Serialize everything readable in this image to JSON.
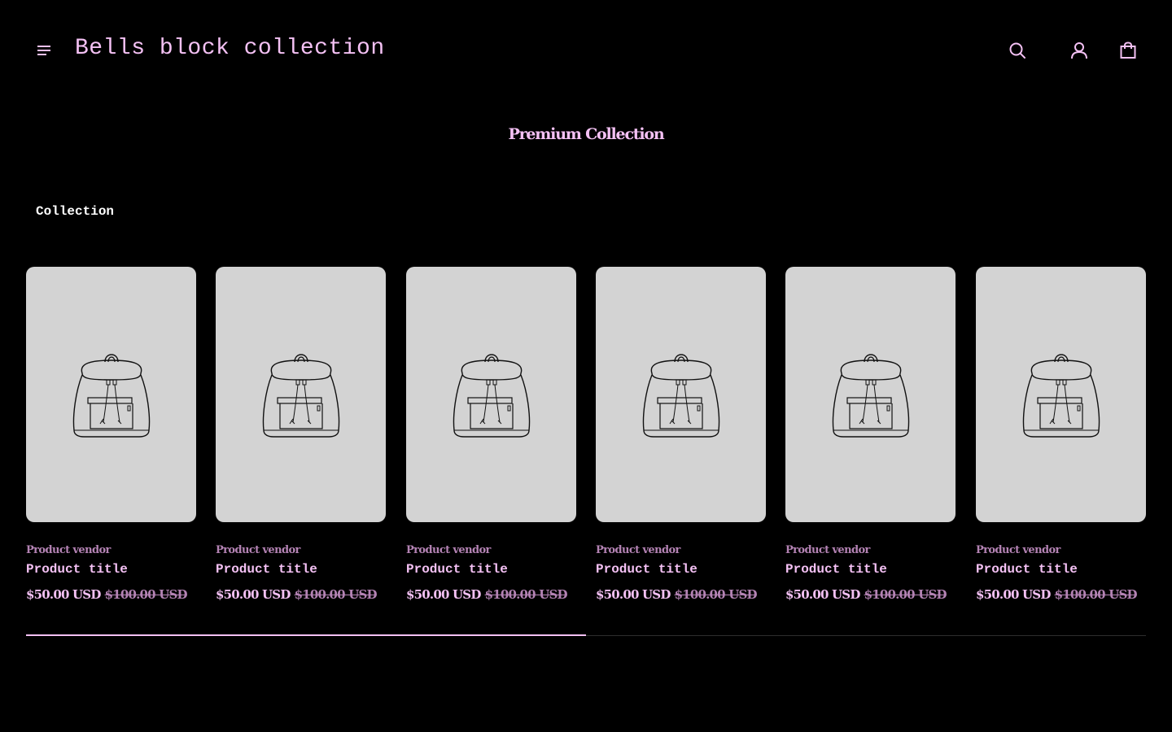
{
  "header": {
    "brand": "Bells block collection",
    "menu_icon": "hamburger-menu-icon",
    "search_icon": "search-icon",
    "account_icon": "account-icon",
    "cart_icon": "shopping-bag-icon"
  },
  "section": {
    "title": "Premium Collection",
    "collection_heading": "Collection"
  },
  "products": [
    {
      "vendor": "Product vendor",
      "title": "Product title",
      "sale_price": "$50.00 USD",
      "regular_price": "$100.00 USD",
      "image_icon": "backpack-placeholder-icon"
    },
    {
      "vendor": "Product vendor",
      "title": "Product title",
      "sale_price": "$50.00 USD",
      "regular_price": "$100.00 USD",
      "image_icon": "backpack-placeholder-icon"
    },
    {
      "vendor": "Product vendor",
      "title": "Product title",
      "sale_price": "$50.00 USD",
      "regular_price": "$100.00 USD",
      "image_icon": "backpack-placeholder-icon"
    },
    {
      "vendor": "Product vendor",
      "title": "Product title",
      "sale_price": "$50.00 USD",
      "regular_price": "$100.00 USD",
      "image_icon": "backpack-placeholder-icon"
    },
    {
      "vendor": "Product vendor",
      "title": "Product title",
      "sale_price": "$50.00 USD",
      "regular_price": "$100.00 USD",
      "image_icon": "backpack-placeholder-icon"
    },
    {
      "vendor": "Product vendor",
      "title": "Product title",
      "sale_price": "$50.00 USD",
      "regular_price": "$100.00 USD",
      "image_icon": "backpack-placeholder-icon"
    }
  ],
  "scrollbar": {
    "progress_fraction": 0.5
  },
  "colors": {
    "background": "#000000",
    "accent": "#f4c1f4",
    "muted_accent": "#b483b4",
    "card_background": "#d3d3d3",
    "heading_white": "#ffffff"
  }
}
